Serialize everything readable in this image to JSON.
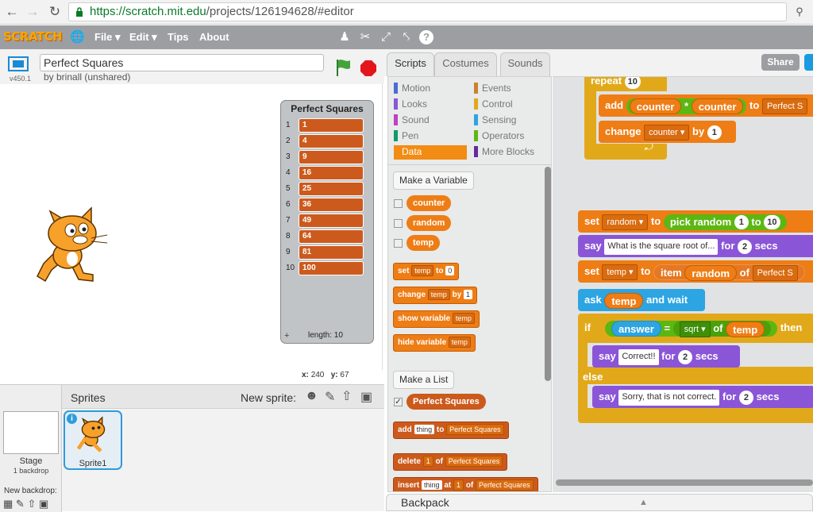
{
  "browser": {
    "url_host": "https://scratch.mit.edu",
    "url_path": "/projects/126194628/#editor"
  },
  "menubar": {
    "logo": "SCRATCH",
    "items": [
      "File ▾",
      "Edit ▾",
      "Tips",
      "About"
    ],
    "icons": [
      "globe-icon",
      "duplicate-icon",
      "cut-icon",
      "grow-icon",
      "shrink-icon",
      "help-icon"
    ]
  },
  "stage_header": {
    "title": "Perfect Squares",
    "byline": "by brinall (unshared)",
    "version": "v450.1"
  },
  "list_monitor": {
    "title": "Perfect Squares",
    "items": [
      "1",
      "4",
      "9",
      "16",
      "25",
      "36",
      "49",
      "64",
      "81",
      "100"
    ],
    "length_label": "length: 10",
    "plus": "+"
  },
  "coords": {
    "x_label": "x:",
    "x": "240",
    "y_label": "y:",
    "y": "67"
  },
  "sprites": {
    "title": "Sprites",
    "new_sprite": "New sprite:",
    "stage_label": "Stage",
    "backdrops": "1 backdrop",
    "new_backdrop": "New backdrop:",
    "sprite1": "Sprite1",
    "info": "i"
  },
  "tabs": [
    "Scripts",
    "Costumes",
    "Sounds"
  ],
  "share": "Share",
  "categories": {
    "left": [
      {
        "label": "Motion",
        "color": "#4a6cd4"
      },
      {
        "label": "Looks",
        "color": "#8a55d7"
      },
      {
        "label": "Sound",
        "color": "#bb42c3"
      },
      {
        "label": "Pen",
        "color": "#0e9a6c"
      },
      {
        "label": "Data",
        "color": "#ee7d16"
      }
    ],
    "right": [
      {
        "label": "Events",
        "color": "#c88330"
      },
      {
        "label": "Control",
        "color": "#e1a91a"
      },
      {
        "label": "Sensing",
        "color": "#2ca5e2"
      },
      {
        "label": "Operators",
        "color": "#5cb712"
      },
      {
        "label": "More Blocks",
        "color": "#632d99"
      }
    ]
  },
  "palette": {
    "make_variable": "Make a Variable",
    "variables": [
      "counter",
      "random",
      "temp"
    ],
    "set": {
      "word": "set",
      "var": "temp",
      "to": "to",
      "val": "0"
    },
    "change": {
      "word": "change",
      "var": "temp",
      "by": "by",
      "val": "1"
    },
    "show": {
      "word": "show variable",
      "var": "temp"
    },
    "hide": {
      "word": "hide variable",
      "var": "temp"
    },
    "make_list": "Make a List",
    "list_name": "Perfect Squares",
    "add": {
      "word": "add",
      "item": "thing",
      "to": "to",
      "list": "Perfect Squares"
    },
    "delete": {
      "word": "delete",
      "idx": "1",
      "of": "of",
      "list": "Perfect Squares"
    },
    "insert": {
      "word": "insert",
      "item": "thing",
      "at": "at",
      "idx": "1",
      "of": "of",
      "list": "Perfect Squares"
    }
  },
  "script": {
    "repeat": {
      "word": "repeat",
      "val": "10"
    },
    "add": {
      "word": "add",
      "a": "counter",
      "op": "*",
      "b": "counter",
      "to": "to",
      "list": "Perfect S"
    },
    "change": {
      "word": "change",
      "var": "counter",
      "by": "by",
      "val": "1"
    },
    "set_random": {
      "word": "set",
      "var": "random",
      "to": "to",
      "pick": "pick random",
      "from": "1",
      "to2": "to",
      "max": "10"
    },
    "say_q": {
      "word": "say",
      "text": "What is the square root of...",
      "for": "for",
      "secs_val": "2",
      "secs": "secs"
    },
    "set_temp": {
      "word": "set",
      "var": "temp",
      "to": "to",
      "item": "item",
      "idx": "random",
      "of": "of",
      "list": "Perfect S"
    },
    "ask": {
      "word": "ask",
      "what": "temp",
      "wait": "and wait"
    },
    "if": {
      "word": "if",
      "answer": "answer",
      "eq": "=",
      "fn": "sqrt",
      "of": "of",
      "var": "temp",
      "then": "then"
    },
    "say_ok": {
      "word": "say",
      "text": "Correct!!",
      "for": "for",
      "secs_val": "2",
      "secs": "secs"
    },
    "else": "else",
    "say_no": {
      "word": "say",
      "text": "Sorry, that is not correct.",
      "for": "for",
      "secs_val": "2",
      "secs": "secs"
    }
  },
  "backpack": "Backpack"
}
